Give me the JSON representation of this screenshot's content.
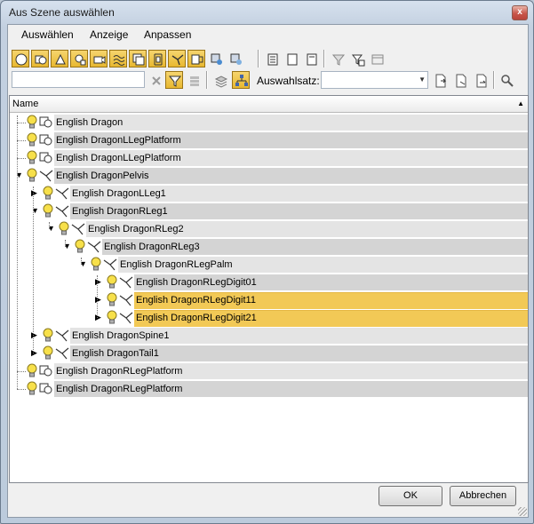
{
  "window": {
    "title": "Aus Szene auswählen",
    "close_label": "x"
  },
  "menu": [
    "Auswählen",
    "Anzeige",
    "Anpassen"
  ],
  "toolbar": {
    "icons_row1": [
      "display-all-icon",
      "display-geometry-icon",
      "display-shapes-icon",
      "display-lights-icon",
      "display-cameras-icon",
      "display-helpers-icon",
      "display-spacewarps-icon",
      "display-groups-icon",
      "display-xrefs-icon",
      "display-bones-icon",
      "display-containers-icon",
      "display-frozen-icon"
    ],
    "icons_row1_b": [
      "properties-icon",
      "list-view-icon",
      "display-children-icon"
    ],
    "icons_row1_c": [
      "filter-icon",
      "filter-settings-icon",
      "extra-icon"
    ],
    "selection_set_label": "Auswahlsatz:",
    "selection_set_value": ""
  },
  "tree": {
    "column_name": "Name",
    "rows": [
      {
        "label": "English Dragon",
        "indent": 0,
        "type": "geo",
        "expander": "none",
        "selected": false
      },
      {
        "label": "English DragonLLegPlatform",
        "indent": 0,
        "type": "geo",
        "expander": "none",
        "selected": false
      },
      {
        "label": "English DragonLLegPlatform",
        "indent": 0,
        "type": "geo",
        "expander": "none",
        "selected": false
      },
      {
        "label": "English DragonPelvis",
        "indent": 0,
        "type": "bone",
        "expander": "open",
        "selected": false
      },
      {
        "label": "English DragonLLeg1",
        "indent": 1,
        "type": "bone",
        "expander": "closed",
        "selected": false
      },
      {
        "label": "English DragonRLeg1",
        "indent": 1,
        "type": "bone",
        "expander": "open",
        "selected": false
      },
      {
        "label": "English DragonRLeg2",
        "indent": 2,
        "type": "bone",
        "expander": "open",
        "selected": false
      },
      {
        "label": "English DragonRLeg3",
        "indent": 3,
        "type": "bone",
        "expander": "open",
        "selected": false
      },
      {
        "label": "English DragonRLegPalm",
        "indent": 4,
        "type": "bone",
        "expander": "open",
        "selected": false
      },
      {
        "label": "English DragonRLegDigit01",
        "indent": 5,
        "type": "bone",
        "expander": "closed",
        "selected": false
      },
      {
        "label": "English DragonRLegDigit11",
        "indent": 5,
        "type": "bone",
        "expander": "closed",
        "selected": true
      },
      {
        "label": "English DragonRLegDigit21",
        "indent": 5,
        "type": "bone",
        "expander": "closed",
        "selected": true
      },
      {
        "label": "English DragonSpine1",
        "indent": 1,
        "type": "bone",
        "expander": "closed",
        "selected": false
      },
      {
        "label": "English DragonTail1",
        "indent": 1,
        "type": "bone",
        "expander": "closed",
        "selected": false
      },
      {
        "label": "English DragonRLegPlatform",
        "indent": 0,
        "type": "geo",
        "expander": "none",
        "selected": false
      },
      {
        "label": "English DragonRLegPlatform",
        "indent": 0,
        "type": "geo",
        "expander": "none",
        "selected": false
      }
    ]
  },
  "footer": {
    "ok_label": "OK",
    "cancel_label": "Abbrechen"
  },
  "colors": {
    "selected_row": "#f2c956",
    "active_toolbar_button": "#e8b830"
  }
}
